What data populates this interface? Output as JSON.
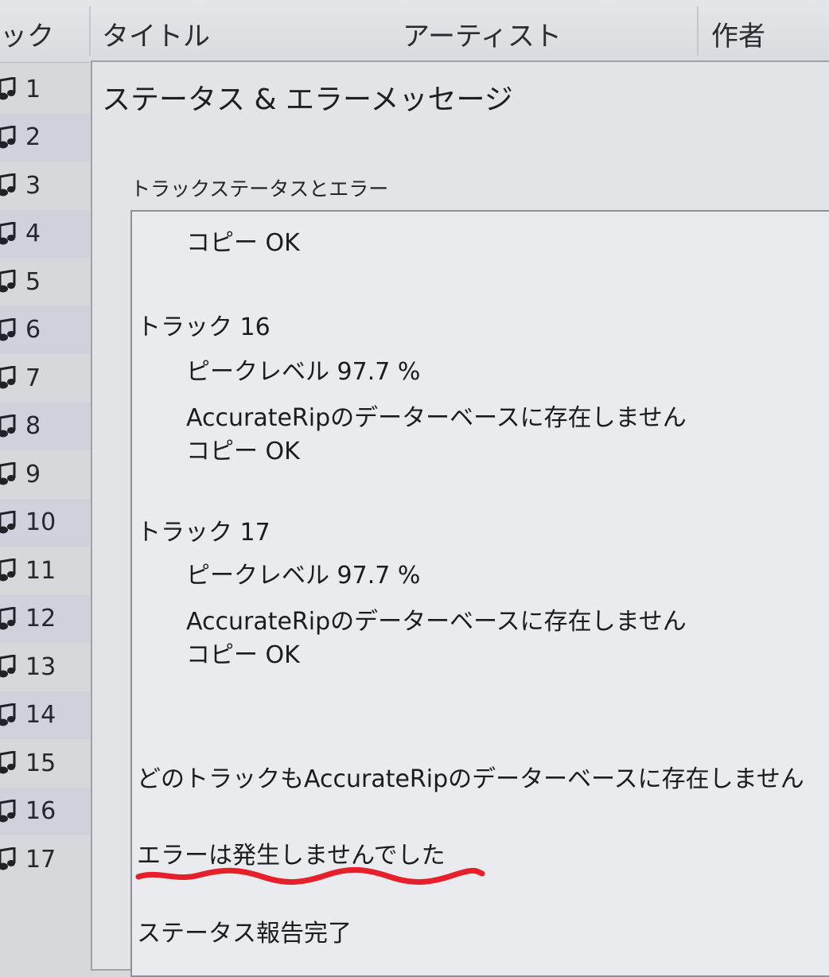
{
  "columns": {
    "track": "ック",
    "title": "タイトル",
    "artist": "アーティスト",
    "author": "作者"
  },
  "tracks": [
    "1",
    "2",
    "3",
    "4",
    "5",
    "6",
    "7",
    "8",
    "9",
    "10",
    "11",
    "12",
    "13",
    "14",
    "15",
    "16",
    "17"
  ],
  "dialog": {
    "title": "ステータス & エラーメッセージ",
    "group_label": "トラックステータスとエラー"
  },
  "messages": {
    "l01": "コピー OK",
    "l02": "トラック 16",
    "l03": "ピークレベル 97.7 %",
    "l04": "AccurateRipのデーターベースに存在しません",
    "l05": "コピー OK",
    "l06": "トラック 17",
    "l07": "ピークレベル 97.7 %",
    "l08": "AccurateRipのデーターベースに存在しません",
    "l09": "コピー OK",
    "l10": "どのトラックもAccurateRipのデーターベースに存在しません",
    "l11": "エラーは発生しませんでした",
    "l12": "ステータス報告完了"
  },
  "colors": {
    "highlight": "#e5202a"
  }
}
